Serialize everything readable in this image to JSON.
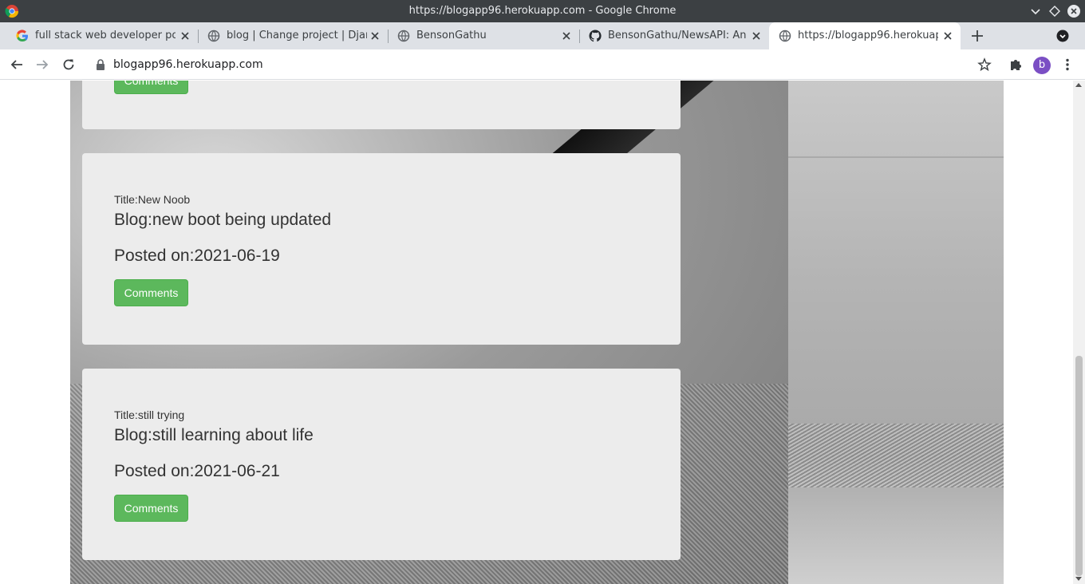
{
  "window": {
    "title": "https://blogapp96.herokuapp.com - Google Chrome"
  },
  "tabs": [
    {
      "label": "full stack web developer portf",
      "icon": "google-icon",
      "active": false
    },
    {
      "label": "blog | Change project | Djang",
      "icon": "globe-icon",
      "active": false
    },
    {
      "label": "BensonGathu",
      "icon": "globe-icon",
      "active": false
    },
    {
      "label": "BensonGathu/NewsAPI: An ap",
      "icon": "github-icon",
      "active": false
    },
    {
      "label": "https://blogapp96.herokuapp",
      "icon": "globe-icon",
      "active": true
    }
  ],
  "toolbar": {
    "url": "blogapp96.herokuapp.com",
    "avatar_letter": "b"
  },
  "top_card": {
    "button_label": "Comments"
  },
  "posts": [
    {
      "title": "Title:New Noob",
      "blog": "Blog:new boot being updated",
      "posted": "Posted on:2021-06-19",
      "button_label": "Comments"
    },
    {
      "title": "Title:still trying",
      "blog": "Blog:still learning about life",
      "posted": "Posted on:2021-06-21",
      "button_label": "Comments"
    }
  ],
  "colors": {
    "button_green": "#5cb85c",
    "card_bg": "#ececec",
    "titlebar": "#3c4043",
    "tabstrip": "#dee1e6",
    "avatar": "#7b4fc4"
  }
}
